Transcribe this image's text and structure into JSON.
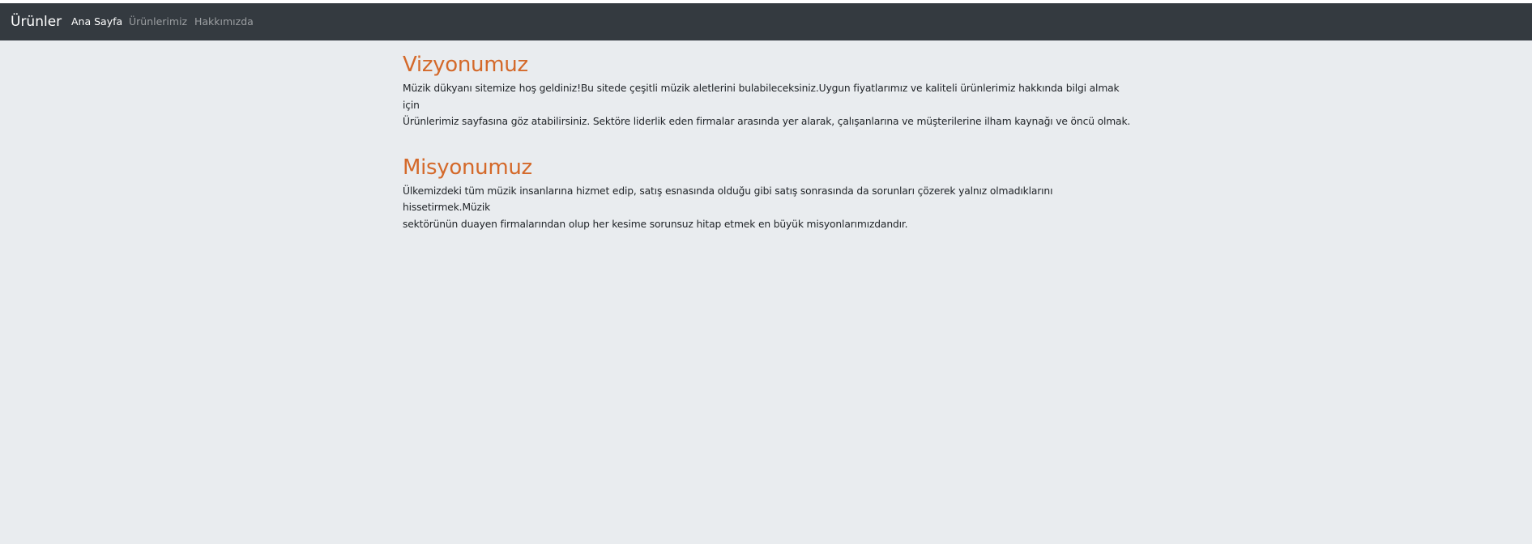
{
  "navbar": {
    "brand": "Ürünler",
    "links": [
      {
        "label": "Ana Sayfa",
        "active": true
      },
      {
        "label": "Ürünlerimiz",
        "active": false
      },
      {
        "label": "Hakkımızda",
        "active": false
      }
    ]
  },
  "sections": [
    {
      "title": "Vizyonumuz",
      "lines": [
        "Müzik dükyanı sitemize hoş geldiniz!Bu sitede çeşitli müzik aletlerini bulabileceksiniz.Uygun fiyatlarımız ve kaliteli ürünlerimiz hakkında bilgi almak için",
        "Ürünlerimiz sayfasına göz atabilirsiniz. Sektöre liderlik eden firmalar arasında yer alarak, çalışanlarına ve müşterilerine ilham kaynağı ve öncü olmak."
      ]
    },
    {
      "title": "Misyonumuz",
      "lines": [
        "Ülkemizdeki tüm müzik insanlarına hizmet edip, satış esnasında olduğu gibi satış sonrasında da sorunları çözerek yalnız olmadıklarını hissetirmek.Müzik",
        "sektörünün duayen firmalarından olup her kesime sorunsuz hitap etmek en büyük misyonlarımızdandır."
      ]
    }
  ]
}
